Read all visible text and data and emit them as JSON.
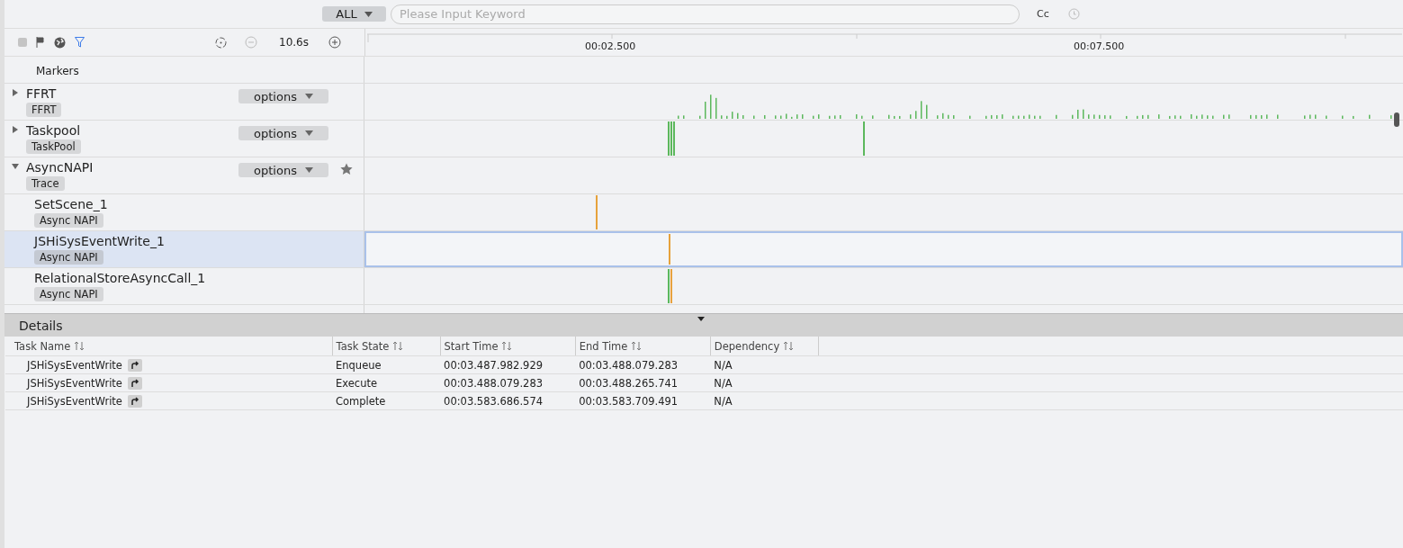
{
  "top_bar": {
    "filter": "ALL",
    "search": {
      "placeholder": "Please Input Keyword"
    },
    "case_toggle": "Cc"
  },
  "toolbar": {
    "zoom_span": "10.6s"
  },
  "ruler": {
    "ticks": [
      "00:02.500",
      "00:07.500"
    ]
  },
  "tracks": [
    {
      "kind": "markers",
      "name": "Markers"
    },
    {
      "kind": "group",
      "name": "FFRT",
      "tag": "FFRT",
      "expanded": false,
      "options": "options",
      "starred": false
    },
    {
      "kind": "group",
      "name": "Taskpool",
      "tag": "TaskPool",
      "expanded": false,
      "options": "options",
      "starred": false
    },
    {
      "kind": "group",
      "name": "AsyncNAPI",
      "tag": "Trace",
      "expanded": true,
      "options": "options",
      "starred": true,
      "children": [
        {
          "name": "SetScene_1",
          "tag": "Async NAPI",
          "selected": false
        },
        {
          "name": "JSHiSysEventWrite_1",
          "tag": "Async NAPI",
          "selected": true
        },
        {
          "name": "RelationalStoreAsyncCall_1",
          "tag": "Async NAPI",
          "selected": false
        }
      ]
    }
  ],
  "details": {
    "title": "Details",
    "columns": [
      "Task Name",
      "Task State",
      "Start Time",
      "End Time",
      "Dependency"
    ],
    "rows": [
      {
        "task_name": "JSHiSysEventWrite",
        "task_state": "Enqueue",
        "start_time": "00:03.487.982.929",
        "end_time": "00:03.488.079.283",
        "dependency": "N/A"
      },
      {
        "task_name": "JSHiSysEventWrite",
        "task_state": "Execute",
        "start_time": "00:03.488.079.283",
        "end_time": "00:03.488.265.741",
        "dependency": "N/A"
      },
      {
        "task_name": "JSHiSysEventWrite",
        "task_state": "Complete",
        "start_time": "00:03.583.686.574",
        "end_time": "00:03.583.709.491",
        "dependency": "N/A"
      }
    ]
  }
}
